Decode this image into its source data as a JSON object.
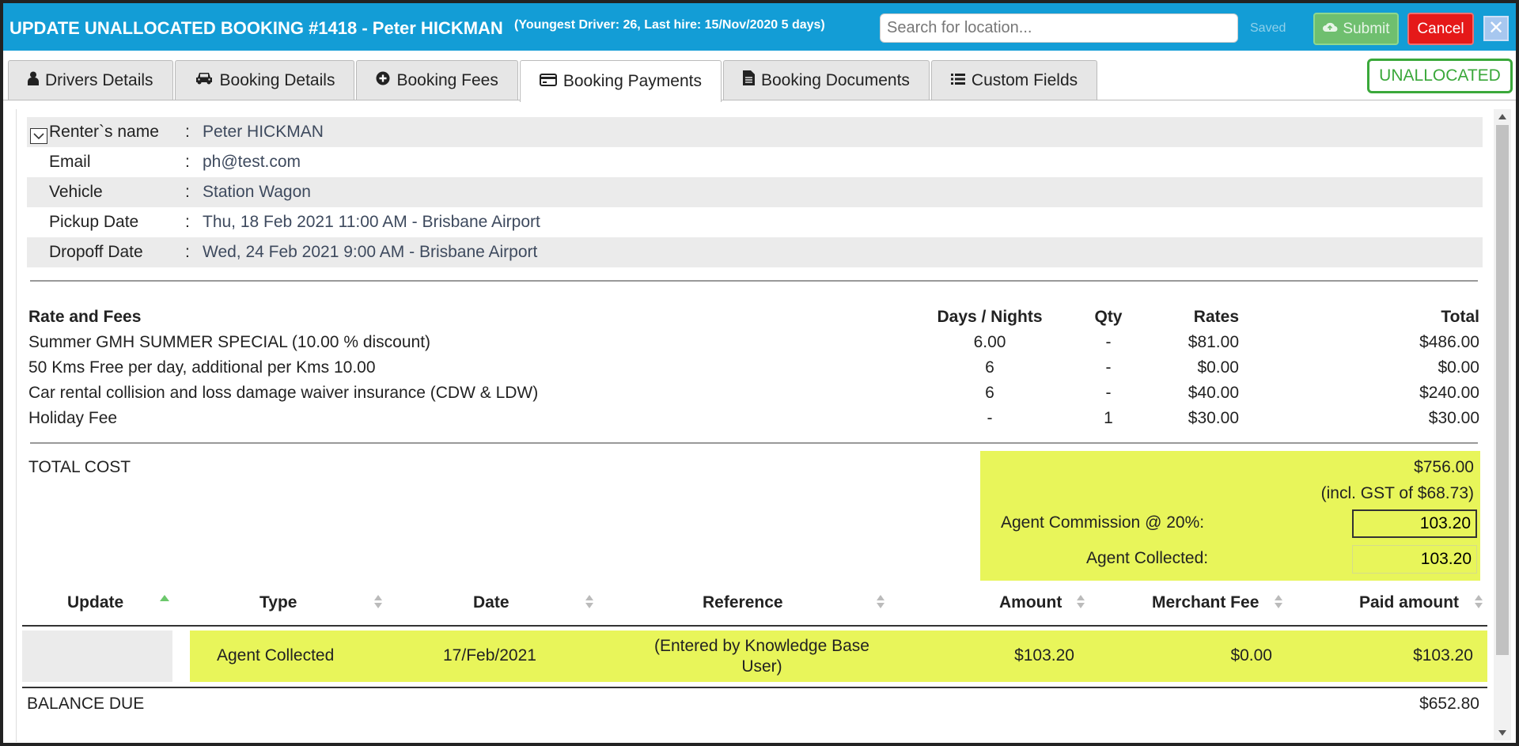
{
  "header": {
    "title": "UPDATE UNALLOCATED BOOKING #1418  - Peter HICKMAN",
    "subtitle": "(Youngest Driver: 26, Last hire: 15/Nov/2020 5 days)",
    "search_placeholder": "Search for location...",
    "saved_label": "Saved",
    "submit_label": "Submit",
    "cancel_label": "Cancel",
    "close_label": "✕"
  },
  "tabs": [
    {
      "label": "Drivers Details",
      "icon": "user-icon"
    },
    {
      "label": "Booking Details",
      "icon": "car-icon"
    },
    {
      "label": "Booking Fees",
      "icon": "plus-circle-icon"
    },
    {
      "label": "Booking Payments",
      "icon": "credit-card-icon",
      "active": true
    },
    {
      "label": "Booking Documents",
      "icon": "document-icon"
    },
    {
      "label": "Custom Fields",
      "icon": "list-icon"
    }
  ],
  "status": "UNALLOCATED",
  "info": [
    {
      "label": "Renter`s name",
      "value": "Peter HICKMAN"
    },
    {
      "label": "Email",
      "value": "ph@test.com"
    },
    {
      "label": "Vehicle",
      "value": "Station Wagon"
    },
    {
      "label": "Pickup Date",
      "value": "Thu, 18 Feb 2021 11:00 AM - Brisbane Airport"
    },
    {
      "label": "Dropoff Date",
      "value": "Wed, 24 Feb 2021 9:00 AM - Brisbane Airport"
    }
  ],
  "info_separator": ":",
  "fees": {
    "headers": {
      "name": "Rate and Fees",
      "days": "Days / Nights",
      "qty": "Qty",
      "rates": "Rates",
      "total": "Total"
    },
    "rows": [
      {
        "name": "Summer GMH SUMMER SPECIAL (10.00 % discount)",
        "days": "6.00",
        "qty": "-",
        "rates": "$81.00",
        "total": "$486.00"
      },
      {
        "name": "50 Kms Free per day, additional per Kms 10.00",
        "days": "6",
        "qty": "-",
        "rates": "$0.00",
        "total": "$0.00"
      },
      {
        "name": "Car rental collision and loss damage waiver insurance (CDW & LDW)",
        "days": "6",
        "qty": "-",
        "rates": "$40.00",
        "total": "$240.00"
      },
      {
        "name": "Holiday Fee",
        "days": "-",
        "qty": "1",
        "rates": "$30.00",
        "total": "$30.00"
      }
    ]
  },
  "totals": {
    "label": "TOTAL COST",
    "total": "$756.00",
    "gst": "(incl. GST of $68.73)",
    "commission_label": "Agent Commission @ 20%:",
    "commission_value": "103.20",
    "collected_label": "Agent Collected:",
    "collected_value": "103.20"
  },
  "payments": {
    "headers": {
      "update": "Update",
      "type": "Type",
      "date": "Date",
      "reference": "Reference",
      "amount": "Amount",
      "merchant_fee": "Merchant Fee",
      "paid_amount": "Paid amount"
    },
    "rows": [
      {
        "type": "Agent Collected",
        "date": "17/Feb/2021",
        "reference_line1": "(Entered by Knowledge Base",
        "reference_line2": "User)",
        "amount": "$103.20",
        "merchant_fee": "$0.00",
        "paid_amount": "$103.20"
      }
    ]
  },
  "balance": {
    "label": "BALANCE DUE",
    "value": "$652.80"
  },
  "colors": {
    "titlebar": "#139dd6",
    "highlight": "#e8f55a",
    "status_green": "#3aa83a",
    "cancel_red": "#e51919"
  }
}
